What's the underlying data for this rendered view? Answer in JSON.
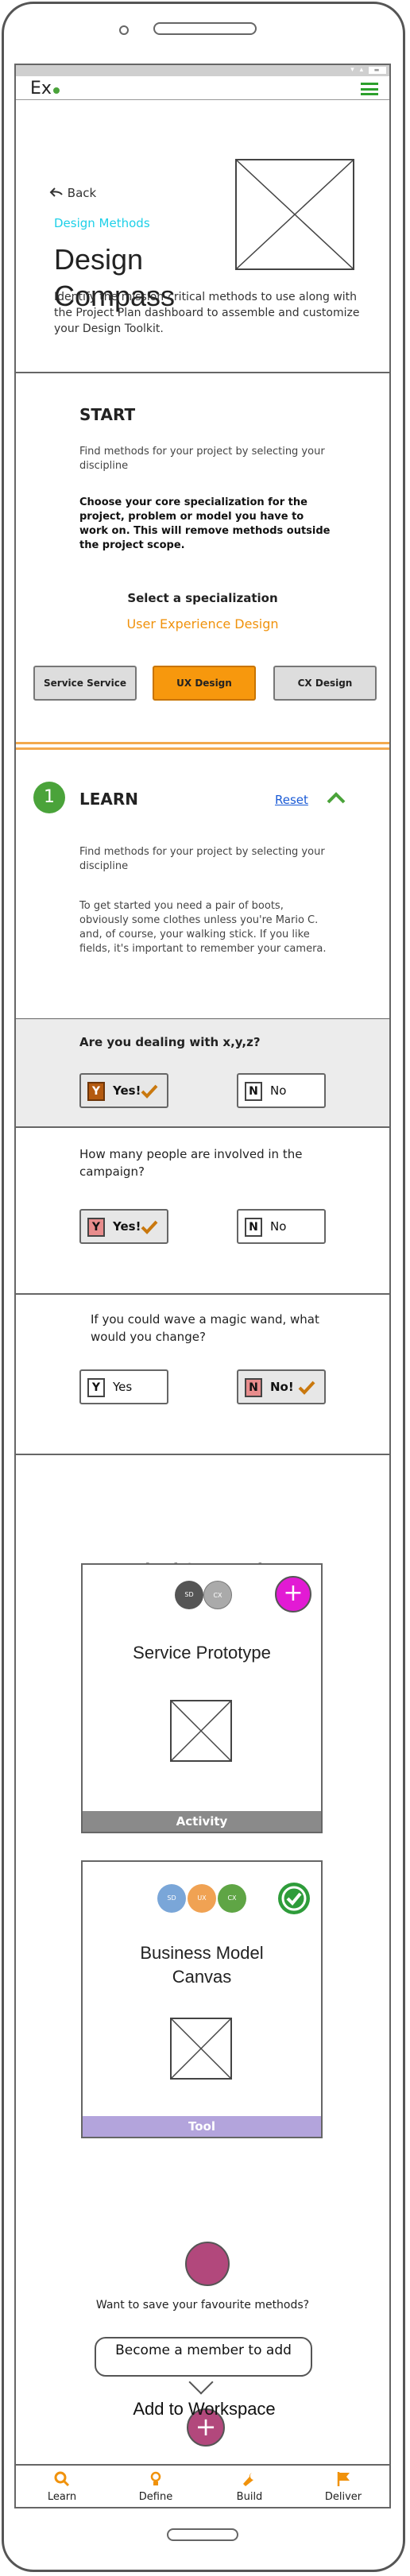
{
  "app": {
    "logo_text": "Ex"
  },
  "nav": {
    "back_label": "Back",
    "breadcrumb": "Design Methods"
  },
  "page": {
    "title_line1": "Design",
    "title_line2": "Compass",
    "intro": "Identify the mission-critical methods to use along with the Project Plan dashboard to assemble and customize your Design Toolkit."
  },
  "start": {
    "heading": "START",
    "desc": "Find methods for your project by selecting your discipline",
    "instruction": "Choose your core specialization for the project, problem or model you have to work on. This will remove methods outside the project scope.",
    "select_label": "Select a specialization",
    "selected_value": "User Experience Design",
    "buttons": [
      "Service Service",
      "UX Design",
      "CX Design"
    ],
    "active_index": 1
  },
  "learn": {
    "step_number": "1",
    "heading": "LEARN",
    "reset_label": "Reset",
    "desc": "Find methods for your project by selecting your discipline",
    "body": "To get started you need a pair of boots, obviously some clothes unless you're Mario C. and, of course, your walking stick. If you like fields, it's important to remember your camera."
  },
  "questions": [
    {
      "text": "Are you dealing with x,y,z?",
      "yes_key": "Y",
      "yes_label": "Yes!",
      "no_key": "N",
      "no_label": "No",
      "answer": "yes"
    },
    {
      "text": "How many people are involved in the campaign?",
      "yes_key": "Y",
      "yes_label": "Yes!",
      "no_key": "N",
      "no_label": "No",
      "answer": "yes"
    },
    {
      "text": "If you could wave a magic wand, what would you change?",
      "yes_key": "Y",
      "yes_label": "Yes",
      "no_key": "N",
      "no_label": "No!",
      "answer": "no"
    }
  ],
  "methods": {
    "heading": "Method Suggestions",
    "cards": [
      {
        "title": "Service Prototype",
        "chips": [
          "SD",
          "CX"
        ],
        "footer": "Activity",
        "footer_color": "#8a8a8a",
        "action": "add"
      },
      {
        "title_line1": "Business Model",
        "title_line2": "Canvas",
        "chips": [
          "SD",
          "UX",
          "CX"
        ],
        "footer": "Tool",
        "footer_color": "#b3a4dc",
        "action": "added"
      }
    ]
  },
  "save": {
    "question": "Want to save your favourite methods?",
    "bubble": "Become a member to add",
    "add_symbol": "+",
    "add_label": "Add to Workspace"
  },
  "tabs": [
    {
      "label": "Learn",
      "icon": "search-icon"
    },
    {
      "label": "Define",
      "icon": "lightbulb-icon"
    },
    {
      "label": "Build",
      "icon": "wrench-icon"
    },
    {
      "label": "Deliver",
      "icon": "flag-icon"
    }
  ],
  "colors": {
    "accent_orange": "#f7980d",
    "accent_green": "#4aa33a",
    "accent_cyan": "#1ed0e8",
    "link_blue": "#1b5bd6",
    "magenta": "#e21ad4",
    "plum": "#b2487c"
  }
}
